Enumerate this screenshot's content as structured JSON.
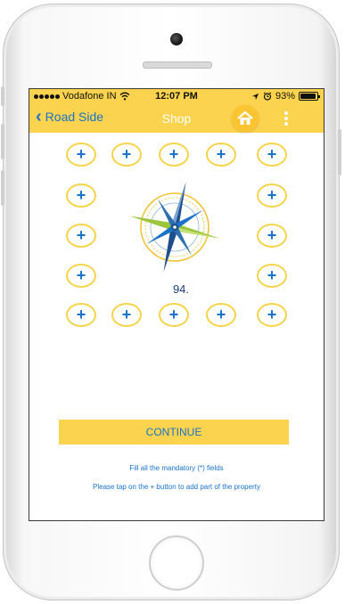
{
  "status_bar": {
    "carrier": "Vodafone IN",
    "time": "12:07 PM",
    "battery": "93%",
    "battery_level": 0.93
  },
  "nav": {
    "back_label": "Road Side",
    "title": "Shop"
  },
  "grid": {
    "button_label": "+"
  },
  "compass": {
    "degree": "94."
  },
  "actions": {
    "continue_label": "CONTINUE"
  },
  "hints": {
    "mandatory": "Fill all the mandatory (*) fields",
    "tap_plus": "Please tap on the + button to add part of the property"
  },
  "colors": {
    "accent_yellow": "#fcd34e",
    "link_blue": "#1a73c9",
    "circle_border": "#f6d44a"
  }
}
